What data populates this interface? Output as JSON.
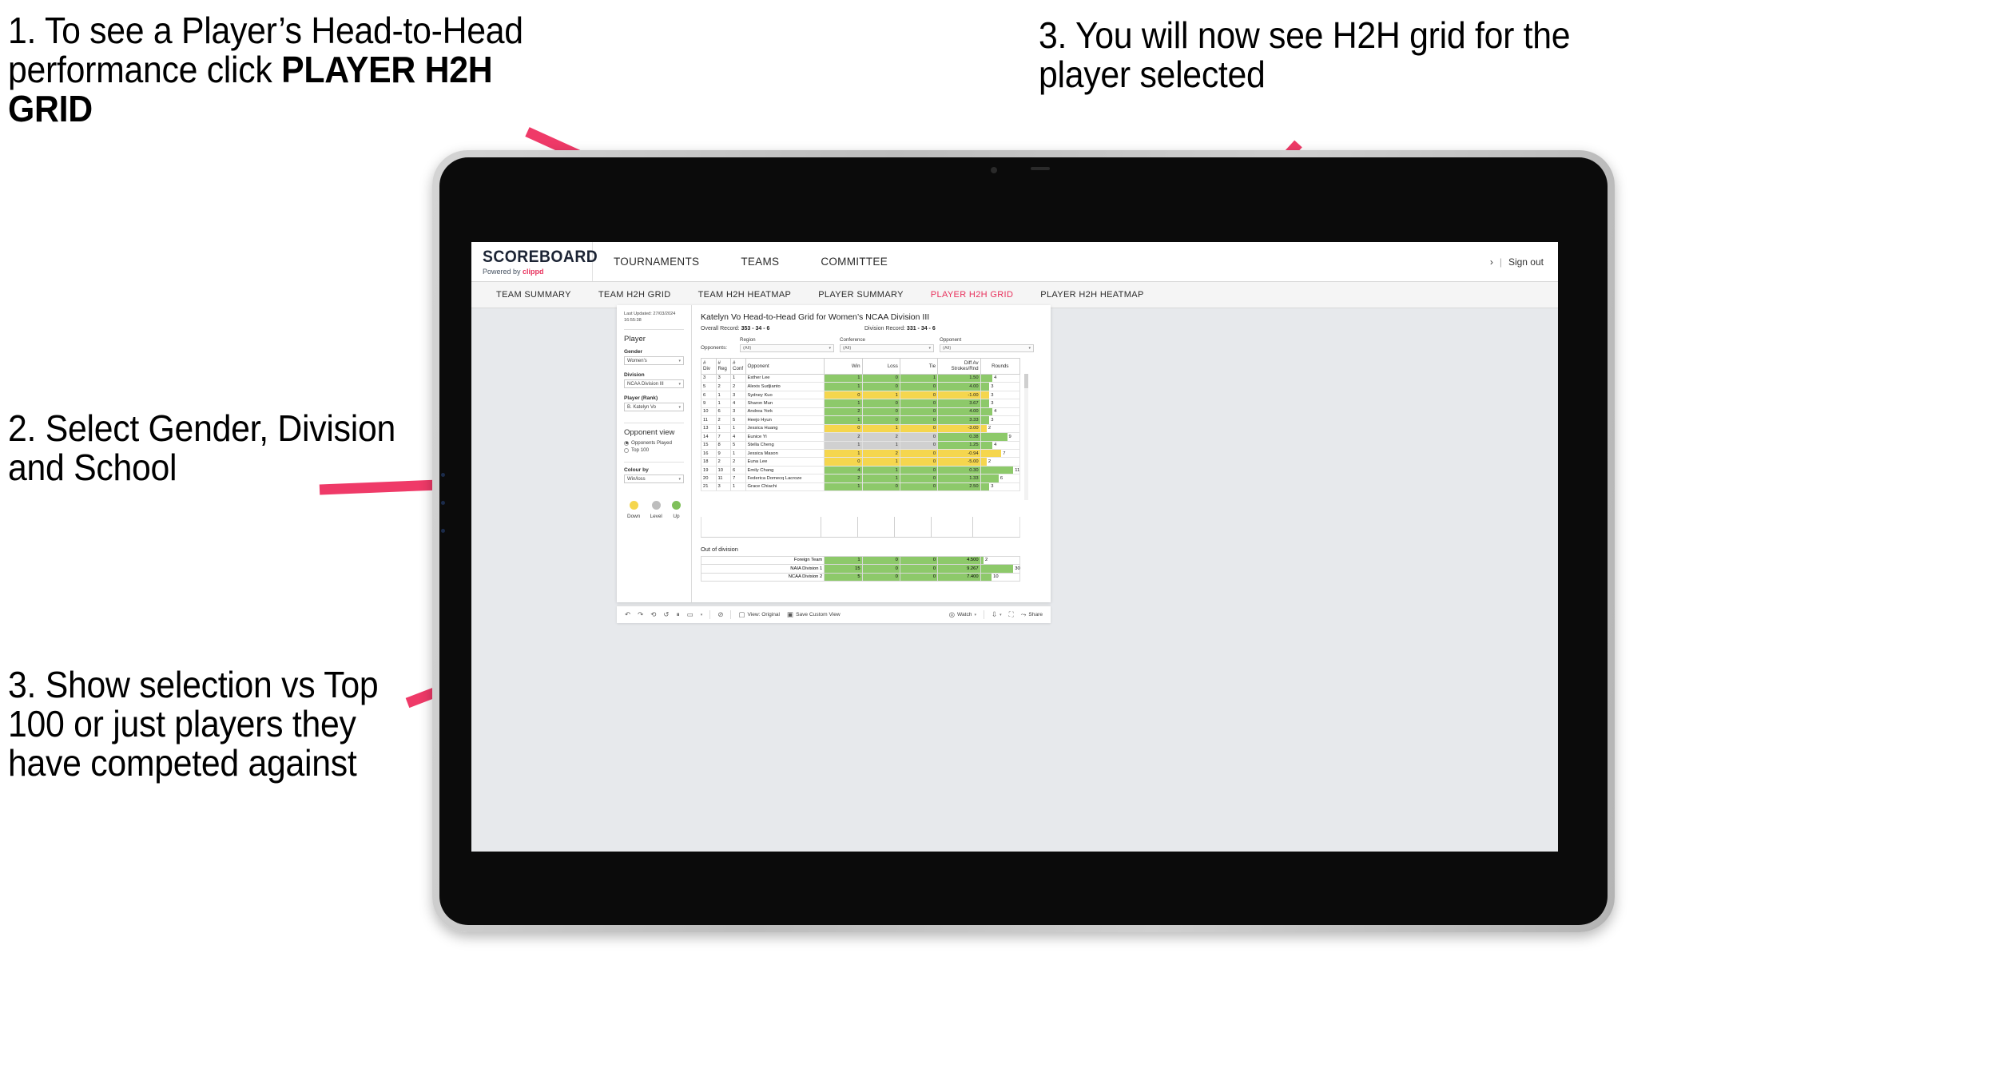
{
  "annotations": [
    {
      "id": "a1",
      "html": true,
      "text_plain": "1. To see a Player’s Head-to-Head performance click ",
      "bold_tail": "PLAYER H2H GRID"
    },
    {
      "id": "a2",
      "text": "2. Select Gender, Division and School"
    },
    {
      "id": "a3",
      "text": "3. Show selection vs Top 100 or just players they have competed against"
    },
    {
      "id": "a4",
      "text": "3. You will now see H2H grid for the player selected"
    }
  ],
  "brand": {
    "logo": "SCOREBOARD",
    "powered_prefix": "Powered by ",
    "powered_name": "clippd"
  },
  "topnav": {
    "items": [
      "TOURNAMENTS",
      "TEAMS",
      "COMMITTEE"
    ],
    "right_chevron": "›",
    "separator": "|",
    "sign_out": "Sign out"
  },
  "subnav": {
    "items": [
      {
        "label": "TEAM SUMMARY",
        "active": false
      },
      {
        "label": "TEAM H2H GRID",
        "active": false
      },
      {
        "label": "TEAM H2H HEATMAP",
        "active": false
      },
      {
        "label": "PLAYER SUMMARY",
        "active": false
      },
      {
        "label": "PLAYER H2H GRID",
        "active": true
      },
      {
        "label": "PLAYER H2H HEATMAP",
        "active": false
      }
    ],
    "active_color": "#e8315c"
  },
  "left_panel": {
    "last_updated": "Last Updated: 27/03/2024 16:55:38",
    "section_player": "Player",
    "gender": {
      "label": "Gender",
      "value": "Women's"
    },
    "division": {
      "label": "Division",
      "value": "NCAA Division III"
    },
    "player_rank": {
      "label": "Player (Rank)",
      "value": "B. Katelyn Vo"
    },
    "opponent_view": {
      "heading": "Opponent view",
      "options": [
        {
          "label": "Opponents Played",
          "selected": true
        },
        {
          "label": "Top 100",
          "selected": false
        }
      ]
    },
    "colour_by": {
      "label": "Colour by",
      "value": "Win/loss"
    },
    "legend": [
      {
        "label": "Down",
        "color": "#f5d64e"
      },
      {
        "label": "Level",
        "color": "#bdbdbd"
      },
      {
        "label": "Up",
        "color": "#7fc05a"
      }
    ]
  },
  "dashboard": {
    "title": "Katelyn Vo Head-to-Head Grid for Women’s NCAA Division III",
    "overall_record_label": "Overall Record: ",
    "overall_record_value": "353 -  34 - 6",
    "division_record_label": "Division Record: ",
    "division_record_value": "331 -  34 - 6",
    "opponents_label": "Opponents:",
    "filters": [
      {
        "label": "Region",
        "value": "(All)"
      },
      {
        "label": "Conference",
        "value": "(All)"
      },
      {
        "label": "Opponent",
        "value": "(All)"
      }
    ],
    "table": {
      "headers": [
        "#\nDiv",
        "#\nReg",
        "#\nConf",
        "Opponent",
        "Win",
        "Loss",
        "Tie",
        "Diff Av\nStrokes/Rnd",
        "Rounds"
      ],
      "rows": [
        {
          "div": "3",
          "reg": "3",
          "conf": "1",
          "opponent": "Esther Lee",
          "win": "1",
          "loss": "0",
          "tie": "1",
          "diff": "1.50",
          "rounds": "4",
          "color": "#8dc96a",
          "bar_pct": 30
        },
        {
          "div": "5",
          "reg": "2",
          "conf": "2",
          "opponent": "Alexis Sudjianto",
          "win": "1",
          "loss": "0",
          "tie": "0",
          "diff": "4.00",
          "rounds": "3",
          "color": "#8dc96a",
          "bar_pct": 22
        },
        {
          "div": "6",
          "reg": "1",
          "conf": "3",
          "opponent": "Sydney Kuo",
          "win": "0",
          "loss": "1",
          "tie": "0",
          "diff": "-1.00",
          "rounds": "3",
          "color": "#f5d64e",
          "bar_pct": 22
        },
        {
          "div": "9",
          "reg": "1",
          "conf": "4",
          "opponent": "Sharon Mun",
          "win": "1",
          "loss": "0",
          "tie": "0",
          "diff": "3.67",
          "rounds": "3",
          "color": "#8dc96a",
          "bar_pct": 22
        },
        {
          "div": "10",
          "reg": "6",
          "conf": "3",
          "opponent": "Andrea York",
          "win": "2",
          "loss": "0",
          "tie": "0",
          "diff": "4.00",
          "rounds": "4",
          "color": "#8dc96a",
          "bar_pct": 30
        },
        {
          "div": "11",
          "reg": "2",
          "conf": "5",
          "opponent": "Heejo Hyun",
          "win": "1",
          "loss": "0",
          "tie": "0",
          "diff": "3.33",
          "rounds": "3",
          "color": "#8dc96a",
          "bar_pct": 22
        },
        {
          "div": "13",
          "reg": "1",
          "conf": "1",
          "opponent": "Jessica Huang",
          "win": "0",
          "loss": "1",
          "tie": "0",
          "diff": "-3.00",
          "rounds": "2",
          "color": "#f5d64e",
          "bar_pct": 15
        },
        {
          "div": "14",
          "reg": "7",
          "conf": "4",
          "opponent": "Eunice Yi",
          "win": "2",
          "loss": "2",
          "tie": "0",
          "diff": "0.38",
          "rounds": "9",
          "color": "#d0d0d0",
          "diff_color": "#8dc96a",
          "bar_pct": 68
        },
        {
          "div": "15",
          "reg": "8",
          "conf": "5",
          "opponent": "Stella Cheng",
          "win": "1",
          "loss": "1",
          "tie": "0",
          "diff": "1.25",
          "rounds": "4",
          "color": "#d0d0d0",
          "diff_color": "#8dc96a",
          "bar_pct": 30
        },
        {
          "div": "16",
          "reg": "9",
          "conf": "1",
          "opponent": "Jessica Mason",
          "win": "1",
          "loss": "2",
          "tie": "0",
          "diff": "-0.94",
          "rounds": "7",
          "color": "#f5d64e",
          "bar_pct": 53
        },
        {
          "div": "18",
          "reg": "2",
          "conf": "2",
          "opponent": "Euna Lee",
          "win": "0",
          "loss": "1",
          "tie": "0",
          "diff": "-5.00",
          "rounds": "2",
          "color": "#f5d64e",
          "bar_pct": 15
        },
        {
          "div": "19",
          "reg": "10",
          "conf": "6",
          "opponent": "Emily Chang",
          "win": "4",
          "loss": "1",
          "tie": "0",
          "diff": "0.30",
          "rounds": "11",
          "color": "#8dc96a",
          "bar_pct": 84
        },
        {
          "div": "20",
          "reg": "11",
          "conf": "7",
          "opponent": "Federica Domecq Lacroze",
          "win": "2",
          "loss": "1",
          "tie": "0",
          "diff": "1.33",
          "rounds": "6",
          "color": "#8dc96a",
          "bar_pct": 46
        },
        {
          "div": "21",
          "reg": "3",
          "conf": "1",
          "opponent": "Grace Chiachi",
          "win": "1",
          "loss": "0",
          "tie": "0",
          "diff": "2.50",
          "rounds": "3",
          "color": "#8dc96a",
          "bar_pct": 22
        }
      ]
    },
    "out_of_division": {
      "title": "Out of division",
      "rows": [
        {
          "name": "Foreign Team",
          "win": "1",
          "loss": "0",
          "tie": "0",
          "diff": "4.500",
          "rounds": "2",
          "color": "#8dc96a",
          "bar_pct": 7
        },
        {
          "name": "NAIA Division 1",
          "win": "15",
          "loss": "0",
          "tie": "0",
          "diff": "9.267",
          "rounds": "30",
          "color": "#8dc96a",
          "bar_pct": 84
        },
        {
          "name": "NCAA Division 2",
          "win": "5",
          "loss": "0",
          "tie": "0",
          "diff": "7.400",
          "rounds": "10",
          "color": "#8dc96a",
          "bar_pct": 28
        }
      ]
    }
  },
  "toolbar": {
    "undo_icon": "↶",
    "redo_icon": "↷",
    "revert_icon": "⟲",
    "refresh_icon": "↺",
    "pause_icon": "⏸",
    "alert_icon": "⊘",
    "view_original": "View: Original",
    "save_custom_view": "Save Custom View",
    "watch": "Watch",
    "share": "Share",
    "caret": "▾"
  },
  "colors": {
    "accent_pink": "#e8315c",
    "green": "#8dc96a",
    "yellow": "#f5d64e",
    "grey": "#d0d0d0",
    "page_bg": "#e7e9ec"
  }
}
